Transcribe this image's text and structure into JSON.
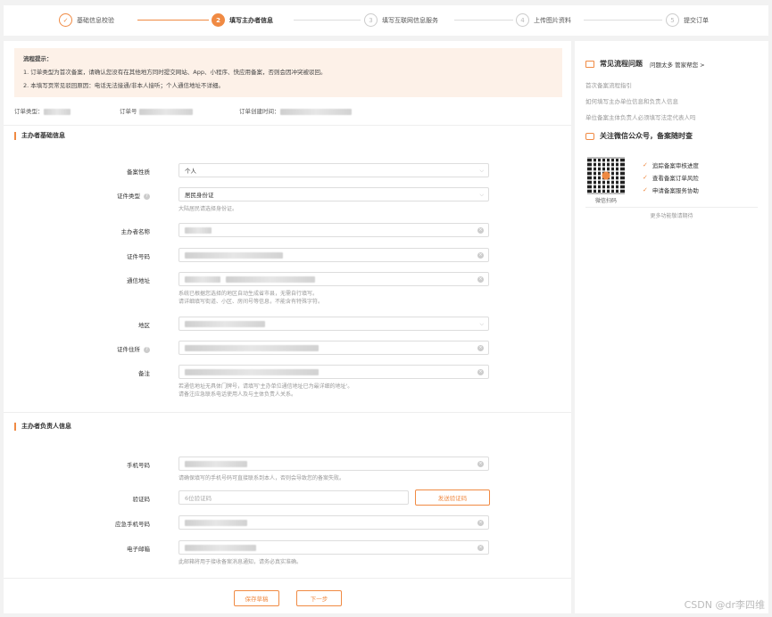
{
  "steps": [
    {
      "num": "✓",
      "label": "基础信息校验"
    },
    {
      "num": "2",
      "label": "填写主办者信息"
    },
    {
      "num": "3",
      "label": "填写互联网信息服务"
    },
    {
      "num": "4",
      "label": "上传图片资料"
    },
    {
      "num": "5",
      "label": "提交订单"
    }
  ],
  "notice": {
    "title": "流程提示：",
    "line1": "1. 订单类型为首次备案，请确认您没有在其他地方同时提交网站、App、小程序、快应用备案，否则会因冲突被驳回。",
    "line2": "2. 本填写页常见驳回原因：电话无法接通/非本人接听；个人通信地址不详细。"
  },
  "order": {
    "type_label": "订单类型：",
    "no_label": "订单号",
    "created_label": "订单创建时间："
  },
  "section1": {
    "title": "主办者基础信息",
    "nature_label": "备案性质",
    "nature_value": "个人",
    "idtype_label": "证件类型",
    "idtype_value": "居民身份证",
    "idtype_hint": "大陆居民请选择身份证。",
    "name_label": "主办者名称",
    "idno_label": "证件号码",
    "addr_label": "通信地址",
    "addr_hint1": "系统已根据您选择的地区自动生成省市县，无需自行填写。",
    "addr_hint2": "请详细填写街道、小区、房间号等信息，不能含有特殊字符。",
    "region_label": "地区",
    "idaddr_label": "证件住所",
    "remark_label": "备注",
    "remark_hint1": "若通信地址无具体门牌号，请填写'主办单位通信地址已为最详细的地址'。",
    "remark_hint2": "请备注应急联系电话使用人及与主体负责人关系。"
  },
  "section2": {
    "title": "主办者负责人信息",
    "phone_label": "手机号码",
    "phone_hint": "请确保填写的手机号码可直接联系到本人，否则会导致您的备案失败。",
    "code_label": "验证码",
    "code_placeholder": "6位验证码",
    "code_button": "发送验证码",
    "emergency_label": "应急手机号码",
    "email_label": "电子邮箱",
    "email_hint": "此邮箱将用于接收备案消息通知，请务必真实准确。"
  },
  "actions": {
    "save": "保存草稿",
    "next": "下一步"
  },
  "side": {
    "faq_title": "常见流程问题",
    "faq_more": "问题太多 管家帮您 >",
    "faq_links": [
      "首次备案流程指引",
      "如何填写主办单位信息和负责人信息",
      "单位备案主体负责人必须填写法定代表人吗"
    ],
    "wechat_title": "关注微信公众号，备案随时查",
    "qr_caption": "微信扫码",
    "features": [
      "追踪备案审核进度",
      "查看备案订单风险",
      "申请备案服务协助"
    ],
    "more_features": "更多功能敬请期待"
  },
  "watermark": "CSDN @dr李四维",
  "colors": {
    "accent": "#f08a43",
    "notice_bg": "#fdf1e8"
  }
}
